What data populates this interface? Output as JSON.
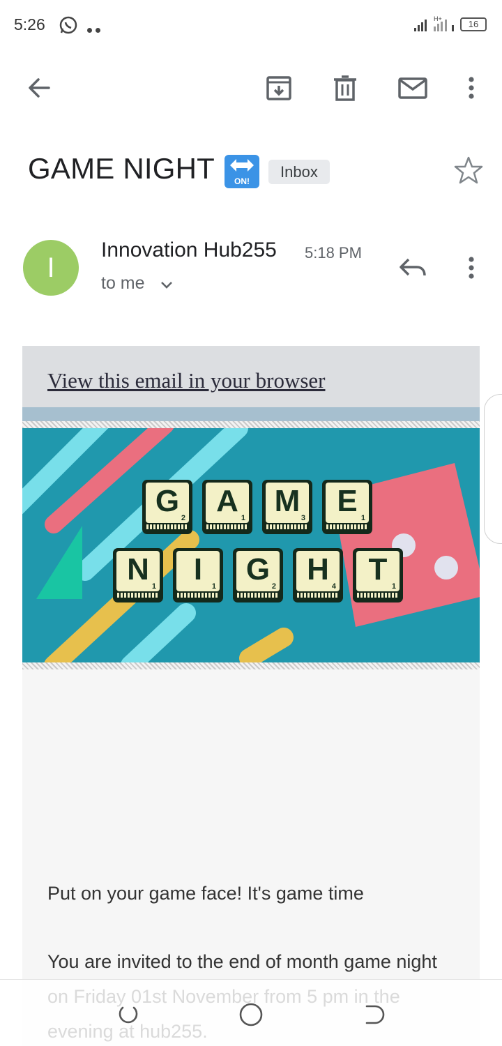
{
  "status_bar": {
    "time": "5:26",
    "network_label": "H+",
    "battery": "16"
  },
  "toolbar": {
    "back_icon": "arrow-left-icon",
    "archive_icon": "archive-icon",
    "delete_icon": "trash-icon",
    "mark_unread_icon": "mail-icon",
    "more_icon": "more-vertical-icon"
  },
  "email": {
    "subject": "GAME NIGHT",
    "subject_emoji": "ON!",
    "label": "Inbox",
    "starred": false,
    "sender": {
      "avatar_letter": "I",
      "avatar_color": "#9ccc65",
      "name": "Innovation Hub255",
      "time": "5:18 PM",
      "recipient": "to me"
    }
  },
  "content": {
    "view_in_browser": "View this email in your browser",
    "banner": {
      "row1": [
        {
          "letter": "G",
          "points": "2"
        },
        {
          "letter": "A",
          "points": "1"
        },
        {
          "letter": "M",
          "points": "3"
        },
        {
          "letter": "E",
          "points": "1"
        }
      ],
      "row2": [
        {
          "letter": "N",
          "points": "1"
        },
        {
          "letter": "I",
          "points": "1"
        },
        {
          "letter": "G",
          "points": "2"
        },
        {
          "letter": "H",
          "points": "4"
        },
        {
          "letter": "T",
          "points": "1"
        }
      ]
    },
    "paragraph1": "Put on your game face! It's game time",
    "paragraph2": "You are invited to the end of month game night on Friday 01st November from 5 pm in the evening at hub255."
  },
  "colors": {
    "banner_bg": "#2098ad",
    "tile_face": "#f3f1c7",
    "tile_border": "#14291b",
    "pink": "#ea6f7f",
    "light_blue": "#78dfea",
    "yellow": "#e7c04d",
    "teal_triangle": "#19c5a3"
  }
}
